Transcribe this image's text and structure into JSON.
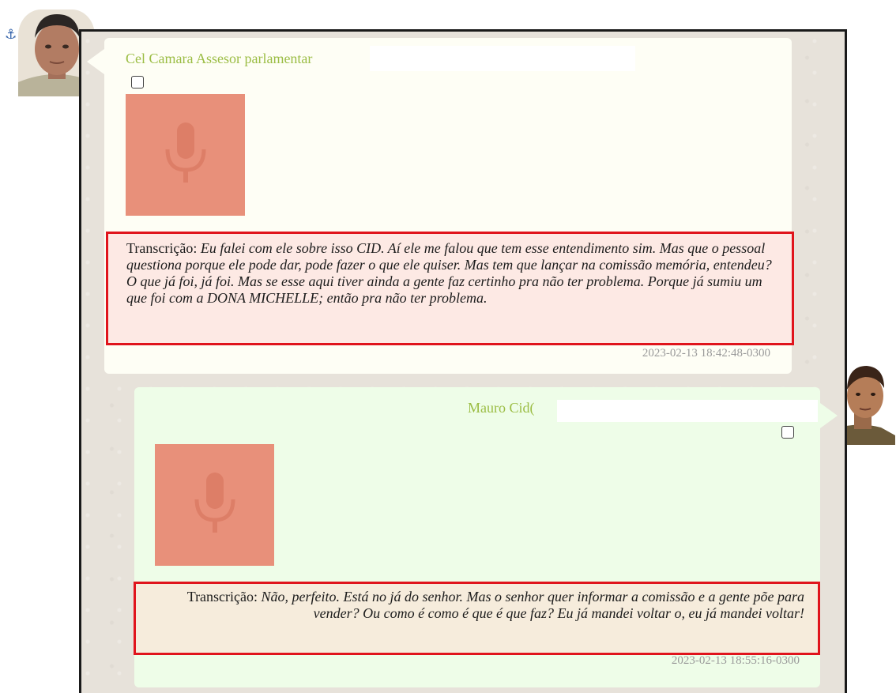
{
  "messages": [
    {
      "sender": "Cel Camara Assesor parlamentar",
      "transcription_label": "Transcrição:",
      "transcription_text": "Eu falei com ele sobre isso CID. Aí ele me falou que tem esse entendimento sim. Mas que o pessoal questiona porque ele pode dar, pode fazer o que ele quiser. Mas tem que lançar na comissão memória, entendeu? O que já foi, já foi. Mas se esse aqui tiver ainda a gente faz certinho pra não ter problema. Porque já sumiu um que foi com a DONA MICHELLE; então pra não ter problema.",
      "timestamp": "2023-02-13 18:42:48-0300",
      "attachment_icon": "microphone-icon"
    },
    {
      "sender": "Mauro Cid(",
      "transcription_label": "Transcrição:",
      "transcription_text": "Não, perfeito. Está no já do senhor. Mas o senhor quer informar a comissão e a gente põe para vender? Ou como é como é que é que faz? Eu já mandei voltar o, eu já mandei voltar!",
      "timestamp": "2023-02-13 18:55:16-0300",
      "attachment_icon": "microphone-icon"
    }
  ],
  "colors": {
    "incoming_bubble": "#fefef5",
    "outgoing_bubble": "#eefde8",
    "sender_name": "#9bbd44",
    "highlight_border": "#e0141c",
    "audio_thumbnail": "#e8907a",
    "anchor": "#2f5fa8"
  },
  "icons": {
    "anchor": "anchor-icon"
  }
}
